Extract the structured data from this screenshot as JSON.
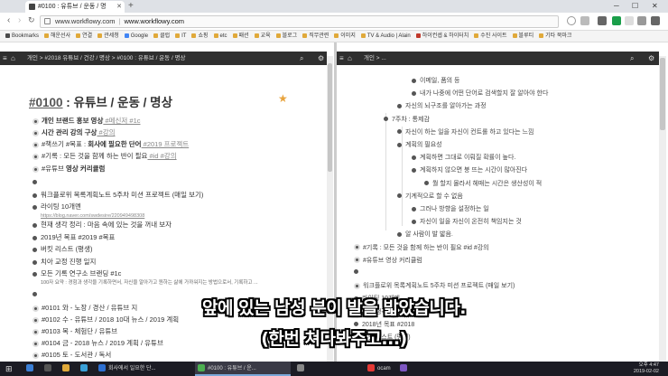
{
  "browser": {
    "tab_title": "#0100 : 유튜브 / 운동 / 명",
    "address_host": "www.workflowy.com",
    "address_title": "www.workflowy.com",
    "back": "‹",
    "forward": "›",
    "reload": "↻",
    "new_tab": "+",
    "minimize": "─",
    "maximize": "☐",
    "close": "✕",
    "tab_close": "✕"
  },
  "bookmarks": [
    {
      "label": "Bookmarks",
      "color": "#4a4a4a"
    },
    {
      "label": "해운선사",
      "color": "#e0a93a"
    },
    {
      "label": "연결",
      "color": "#e0a93a"
    },
    {
      "label": "관세청",
      "color": "#e0a93a"
    },
    {
      "label": "Google",
      "color": "#4285f4"
    },
    {
      "label": "클럽",
      "color": "#e0a93a"
    },
    {
      "label": "IT",
      "color": "#e0a93a"
    },
    {
      "label": "쇼핑",
      "color": "#e0a93a"
    },
    {
      "label": "etc",
      "color": "#e0a93a"
    },
    {
      "label": "패션",
      "color": "#e0a93a"
    },
    {
      "label": "교육",
      "color": "#e0a93a"
    },
    {
      "label": "블로그",
      "color": "#e0a93a"
    },
    {
      "label": "직무관련",
      "color": "#e0a93a"
    },
    {
      "label": "이미지",
      "color": "#e0a93a"
    },
    {
      "label": "TV & Audio | Alain",
      "color": "#e0a93a"
    },
    {
      "label": "하이컨셉 & 하이터치",
      "color": "#c0392b"
    },
    {
      "label": "수진 사이트",
      "color": "#e0a93a"
    },
    {
      "label": "블루티",
      "color": "#e0a93a"
    },
    {
      "label": "기타 북마크",
      "color": "#e0a93a"
    }
  ],
  "left_pane": {
    "breadcrumb": "개인  >  #2018 유튜브 / 건강 / 명상  >  #0100 : 유튜브 / 운동 / 명상",
    "title_hash": "#0100",
    "title_rest": " : 유튜브 / 운동 / 명상",
    "rows": [
      {
        "type": "ring",
        "bold": "개인 브랜드 홍보 영상",
        "tail": " #메신저 #1c"
      },
      {
        "type": "ring",
        "bold": "시간 관리 강의 구상",
        "tail": " #강의"
      },
      {
        "type": "ring",
        "pre": "#책쓰기 #목표 : ",
        "bold": "회사에 필요한 단어",
        "tail": " #2019 프로젝트"
      },
      {
        "type": "ring",
        "pre": "#기록 : 모든 것을 함께 하는 반이 필요",
        "tail": " #id #강의"
      },
      {
        "type": "ring",
        "pre": "#유튜브 ",
        "bold": "영상 커리큘럼",
        "tail": ""
      },
      {
        "type": "dot",
        "pre": "",
        "tail": ""
      },
      {
        "type": "dot",
        "pre": "워크플로위 목록계획노트 5주차 미션 프로젝트 (매일 보기)",
        "tail": ""
      },
      {
        "type": "dot",
        "pre": "라이팅 10개멘",
        "tail": ""
      },
      {
        "type": "link",
        "pre": "https://blog.naver.com/swdesire/220949498308",
        "tail": ""
      },
      {
        "type": "dot",
        "pre": "현재 생각 정리 : 마음 속에 있는 것을 꺼내 보자",
        "tail": ""
      },
      {
        "type": "dot",
        "pre": "2019년 목표 #2019 #목표",
        "tail": ""
      },
      {
        "type": "dot",
        "pre": "버킷 리스트 (평생)",
        "tail": ""
      },
      {
        "type": "dot",
        "pre": "치아 교정 진행 일지",
        "tail": ""
      },
      {
        "type": "dot",
        "pre": "모든 기록 연구소 브랜딩 #1c",
        "tail": ""
      },
      {
        "type": "small",
        "pre": "100자 요약 : 경험과 생각을 기록하면서, 자신을 알아가고 원하는 삶에 가까워지는 방법으로서, 기록하고 ...",
        "tail": ""
      },
      {
        "type": "dot",
        "pre": "",
        "tail": ""
      },
      {
        "type": "ring",
        "pre": "#0101 와 - 노장 / 경산 / 유튜브 지",
        "tail": ""
      },
      {
        "type": "ring",
        "pre": "#0102 수 - 유튜브 / 2018 10대 뉴스 / 2019 계획",
        "tail": ""
      },
      {
        "type": "ring",
        "pre": "#0103 목 - 체험단 / 유튜브",
        "tail": ""
      },
      {
        "type": "ring",
        "pre": "#0104 금 - 2018 뉴스 / 2019 계획 / 유튜브",
        "tail": ""
      },
      {
        "type": "ring",
        "pre": "#0105 토 - 도서관 / 독서",
        "tail": ""
      }
    ]
  },
  "right_pane": {
    "breadcrumb": "개인  >  ...",
    "rows": [
      {
        "indent": 1,
        "text": "이메일, 품의 등",
        "style": "dot"
      },
      {
        "indent": 1,
        "text": "내가 나중에 어떤 단어로 검색할지 잘 알아야 한다",
        "style": "dot"
      },
      {
        "indent": 0,
        "text": "자신의 뇌구조를 알아가는 과정",
        "style": "dot"
      },
      {
        "indent": -1,
        "text": "7주차 : 통제감",
        "style": "dot"
      },
      {
        "indent": 0,
        "text": "자신이 하는 일을 자신이 컨트롤 하고 있다는 느낌",
        "style": "dot"
      },
      {
        "indent": 0,
        "text": "계획의 필요성",
        "style": "dot"
      },
      {
        "indent": 1,
        "text": "계획하면 그대로 이뤄질 확률이 높다.",
        "style": "dot"
      },
      {
        "indent": 1,
        "text": "계획하지 않으면 붕 뜨는 시간이 많아진다",
        "style": "dot"
      },
      {
        "indent": 2,
        "text": "뭘 할지 몰라서 헤매는 시간은 생산성이 적",
        "style": "dot"
      },
      {
        "indent": 0,
        "text": "기계적으로 할 수 없음",
        "style": "dot"
      },
      {
        "indent": 1,
        "text": "그러나 방향을 설정하는 일",
        "style": "dot"
      },
      {
        "indent": 1,
        "text": "자신이 일을 자신이 온전히 책임지는 것",
        "style": "dot"
      },
      {
        "indent": 0,
        "text": "알 사람이 발 밟음.",
        "style": "dot"
      },
      {
        "indent": -2,
        "text": "#기록 : 모든 것을 함께 하는 반이 필요 #id #강의",
        "style": "ring"
      },
      {
        "indent": -2,
        "text": "#유튜브 영상 커리큘럼",
        "style": "ring"
      },
      {
        "indent": -2,
        "text": "",
        "style": "dot"
      },
      {
        "indent": -2,
        "text": "워크플로위 목록계획노트 5주차 미션 프로젝트 (매일 보기)",
        "style": "ring"
      },
      {
        "indent": -2,
        "text": "라이팅 10개멘",
        "style": "dot"
      },
      {
        "indent": -2,
        "text": "현재 생각 정리",
        "style": "dot"
      },
      {
        "indent": -2,
        "text": "2018년 목표 #2018",
        "style": "dot"
      },
      {
        "indent": -2,
        "text": "버킷 리스트 (평생)",
        "style": "dot"
      }
    ]
  },
  "subtitles": {
    "line1": "앞에 있는 남성 분이 발을 밟았습니다.",
    "line2": "(한번 쳐다봐주고...)"
  },
  "taskbar": {
    "items": [
      {
        "label": "",
        "color": "#3b7fd6"
      },
      {
        "label": "",
        "color": "#555"
      },
      {
        "label": "",
        "color": "#e0a93a"
      },
      {
        "label": "",
        "color": "#3aa0d8"
      },
      {
        "label": "회사에서 일요한 단...",
        "color": "#2d6fd1"
      },
      {
        "label": "#0100 : 유튜브 / 운...",
        "color": "#4caf50"
      },
      {
        "label": "",
        "color": "#888"
      },
      {
        "label": "ocam",
        "color": "#e53935"
      },
      {
        "label": "",
        "color": "#7e57c2"
      }
    ],
    "time": "오후 4:47",
    "date": "2019-02-02"
  }
}
